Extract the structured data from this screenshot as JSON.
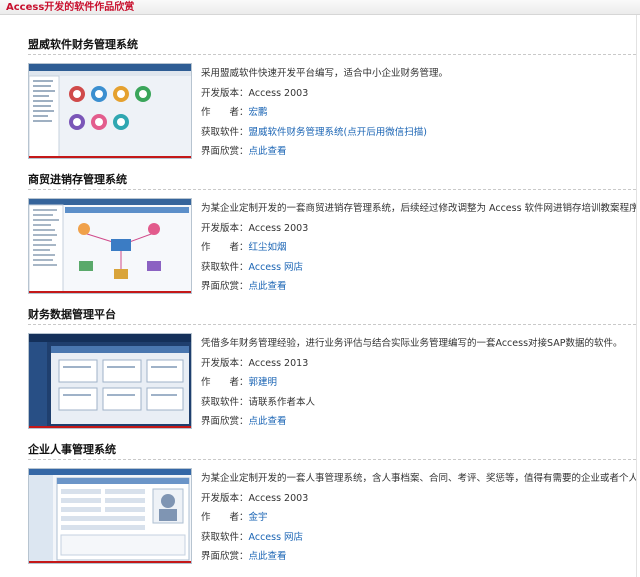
{
  "header": {
    "title": "Access开发的软件作品欣赏"
  },
  "labels": {
    "version": "开发版本：",
    "author": "作　　者：",
    "get": "获取软件：",
    "view": "界面欣赏："
  },
  "items": [
    {
      "title": "盟威软件财务管理系统",
      "description": "采用盟威软件快速开发平台编写，适合中小企业财务管理。",
      "version": "Access 2003",
      "author": "宏鹏",
      "get": "盟威软件财务管理系统(点开后用微信扫描)",
      "view": "点此查看"
    },
    {
      "title": "商贸进销存管理系统",
      "description": "为某企业定制开发的一套商贸进销存管理系统，后续经过修改调整为 Access 软件网进销存培训教案程序。",
      "version": "Access 2003",
      "author": "红尘如烟",
      "get": "Access 网店",
      "view": "点此查看"
    },
    {
      "title": "财务数据管理平台",
      "description": "凭借多年财务管理经验，进行业务评估与结合实际业务管理编写的一套Access对接SAP数据的软件。",
      "version": "Access 2013",
      "author": "郭建明",
      "get": "请联系作者本人",
      "view": "点此查看"
    },
    {
      "title": "企业人事管理系统",
      "description": "为某企业定制开发的一套人事管理系统，含人事档案、合同、考评、奖惩等，值得有需要的企业或者个人借鉴参考学习。",
      "version": "Access 2003",
      "author": "金宇",
      "get": "Access 网店",
      "view": "点此查看"
    }
  ]
}
